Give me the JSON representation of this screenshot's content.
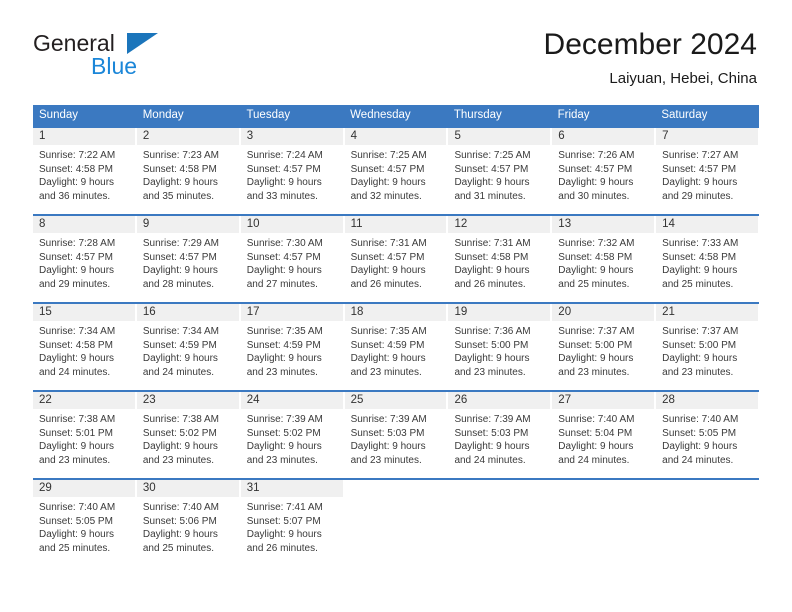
{
  "logo": {
    "word1": "General",
    "word2": "Blue",
    "triangle_color": "#1b75bb",
    "word2_color": "#1b86d8"
  },
  "header": {
    "title": "December 2024",
    "subtitle": "Laiyuan, Hebei, China"
  },
  "theme": {
    "header_bg": "#3b79c1",
    "header_text": "#ffffff",
    "daynum_bg": "#f0f0f0",
    "cell_bg": "#ffffff",
    "text": "#3a3a3a"
  },
  "weekdays": [
    "Sunday",
    "Monday",
    "Tuesday",
    "Wednesday",
    "Thursday",
    "Friday",
    "Saturday"
  ],
  "weeks": [
    [
      {
        "day": "1",
        "sunrise": "Sunrise: 7:22 AM",
        "sunset": "Sunset: 4:58 PM",
        "daylight1": "Daylight: 9 hours",
        "daylight2": "and 36 minutes."
      },
      {
        "day": "2",
        "sunrise": "Sunrise: 7:23 AM",
        "sunset": "Sunset: 4:58 PM",
        "daylight1": "Daylight: 9 hours",
        "daylight2": "and 35 minutes."
      },
      {
        "day": "3",
        "sunrise": "Sunrise: 7:24 AM",
        "sunset": "Sunset: 4:57 PM",
        "daylight1": "Daylight: 9 hours",
        "daylight2": "and 33 minutes."
      },
      {
        "day": "4",
        "sunrise": "Sunrise: 7:25 AM",
        "sunset": "Sunset: 4:57 PM",
        "daylight1": "Daylight: 9 hours",
        "daylight2": "and 32 minutes."
      },
      {
        "day": "5",
        "sunrise": "Sunrise: 7:25 AM",
        "sunset": "Sunset: 4:57 PM",
        "daylight1": "Daylight: 9 hours",
        "daylight2": "and 31 minutes."
      },
      {
        "day": "6",
        "sunrise": "Sunrise: 7:26 AM",
        "sunset": "Sunset: 4:57 PM",
        "daylight1": "Daylight: 9 hours",
        "daylight2": "and 30 minutes."
      },
      {
        "day": "7",
        "sunrise": "Sunrise: 7:27 AM",
        "sunset": "Sunset: 4:57 PM",
        "daylight1": "Daylight: 9 hours",
        "daylight2": "and 29 minutes."
      }
    ],
    [
      {
        "day": "8",
        "sunrise": "Sunrise: 7:28 AM",
        "sunset": "Sunset: 4:57 PM",
        "daylight1": "Daylight: 9 hours",
        "daylight2": "and 29 minutes."
      },
      {
        "day": "9",
        "sunrise": "Sunrise: 7:29 AM",
        "sunset": "Sunset: 4:57 PM",
        "daylight1": "Daylight: 9 hours",
        "daylight2": "and 28 minutes."
      },
      {
        "day": "10",
        "sunrise": "Sunrise: 7:30 AM",
        "sunset": "Sunset: 4:57 PM",
        "daylight1": "Daylight: 9 hours",
        "daylight2": "and 27 minutes."
      },
      {
        "day": "11",
        "sunrise": "Sunrise: 7:31 AM",
        "sunset": "Sunset: 4:57 PM",
        "daylight1": "Daylight: 9 hours",
        "daylight2": "and 26 minutes."
      },
      {
        "day": "12",
        "sunrise": "Sunrise: 7:31 AM",
        "sunset": "Sunset: 4:58 PM",
        "daylight1": "Daylight: 9 hours",
        "daylight2": "and 26 minutes."
      },
      {
        "day": "13",
        "sunrise": "Sunrise: 7:32 AM",
        "sunset": "Sunset: 4:58 PM",
        "daylight1": "Daylight: 9 hours",
        "daylight2": "and 25 minutes."
      },
      {
        "day": "14",
        "sunrise": "Sunrise: 7:33 AM",
        "sunset": "Sunset: 4:58 PM",
        "daylight1": "Daylight: 9 hours",
        "daylight2": "and 25 minutes."
      }
    ],
    [
      {
        "day": "15",
        "sunrise": "Sunrise: 7:34 AM",
        "sunset": "Sunset: 4:58 PM",
        "daylight1": "Daylight: 9 hours",
        "daylight2": "and 24 minutes."
      },
      {
        "day": "16",
        "sunrise": "Sunrise: 7:34 AM",
        "sunset": "Sunset: 4:59 PM",
        "daylight1": "Daylight: 9 hours",
        "daylight2": "and 24 minutes."
      },
      {
        "day": "17",
        "sunrise": "Sunrise: 7:35 AM",
        "sunset": "Sunset: 4:59 PM",
        "daylight1": "Daylight: 9 hours",
        "daylight2": "and 23 minutes."
      },
      {
        "day": "18",
        "sunrise": "Sunrise: 7:35 AM",
        "sunset": "Sunset: 4:59 PM",
        "daylight1": "Daylight: 9 hours",
        "daylight2": "and 23 minutes."
      },
      {
        "day": "19",
        "sunrise": "Sunrise: 7:36 AM",
        "sunset": "Sunset: 5:00 PM",
        "daylight1": "Daylight: 9 hours",
        "daylight2": "and 23 minutes."
      },
      {
        "day": "20",
        "sunrise": "Sunrise: 7:37 AM",
        "sunset": "Sunset: 5:00 PM",
        "daylight1": "Daylight: 9 hours",
        "daylight2": "and 23 minutes."
      },
      {
        "day": "21",
        "sunrise": "Sunrise: 7:37 AM",
        "sunset": "Sunset: 5:00 PM",
        "daylight1": "Daylight: 9 hours",
        "daylight2": "and 23 minutes."
      }
    ],
    [
      {
        "day": "22",
        "sunrise": "Sunrise: 7:38 AM",
        "sunset": "Sunset: 5:01 PM",
        "daylight1": "Daylight: 9 hours",
        "daylight2": "and 23 minutes."
      },
      {
        "day": "23",
        "sunrise": "Sunrise: 7:38 AM",
        "sunset": "Sunset: 5:02 PM",
        "daylight1": "Daylight: 9 hours",
        "daylight2": "and 23 minutes."
      },
      {
        "day": "24",
        "sunrise": "Sunrise: 7:39 AM",
        "sunset": "Sunset: 5:02 PM",
        "daylight1": "Daylight: 9 hours",
        "daylight2": "and 23 minutes."
      },
      {
        "day": "25",
        "sunrise": "Sunrise: 7:39 AM",
        "sunset": "Sunset: 5:03 PM",
        "daylight1": "Daylight: 9 hours",
        "daylight2": "and 23 minutes."
      },
      {
        "day": "26",
        "sunrise": "Sunrise: 7:39 AM",
        "sunset": "Sunset: 5:03 PM",
        "daylight1": "Daylight: 9 hours",
        "daylight2": "and 24 minutes."
      },
      {
        "day": "27",
        "sunrise": "Sunrise: 7:40 AM",
        "sunset": "Sunset: 5:04 PM",
        "daylight1": "Daylight: 9 hours",
        "daylight2": "and 24 minutes."
      },
      {
        "day": "28",
        "sunrise": "Sunrise: 7:40 AM",
        "sunset": "Sunset: 5:05 PM",
        "daylight1": "Daylight: 9 hours",
        "daylight2": "and 24 minutes."
      }
    ],
    [
      {
        "day": "29",
        "sunrise": "Sunrise: 7:40 AM",
        "sunset": "Sunset: 5:05 PM",
        "daylight1": "Daylight: 9 hours",
        "daylight2": "and 25 minutes."
      },
      {
        "day": "30",
        "sunrise": "Sunrise: 7:40 AM",
        "sunset": "Sunset: 5:06 PM",
        "daylight1": "Daylight: 9 hours",
        "daylight2": "and 25 minutes."
      },
      {
        "day": "31",
        "sunrise": "Sunrise: 7:41 AM",
        "sunset": "Sunset: 5:07 PM",
        "daylight1": "Daylight: 9 hours",
        "daylight2": "and 26 minutes."
      },
      {
        "day": "",
        "sunrise": "",
        "sunset": "",
        "daylight1": "",
        "daylight2": ""
      },
      {
        "day": "",
        "sunrise": "",
        "sunset": "",
        "daylight1": "",
        "daylight2": ""
      },
      {
        "day": "",
        "sunrise": "",
        "sunset": "",
        "daylight1": "",
        "daylight2": ""
      },
      {
        "day": "",
        "sunrise": "",
        "sunset": "",
        "daylight1": "",
        "daylight2": ""
      }
    ]
  ]
}
